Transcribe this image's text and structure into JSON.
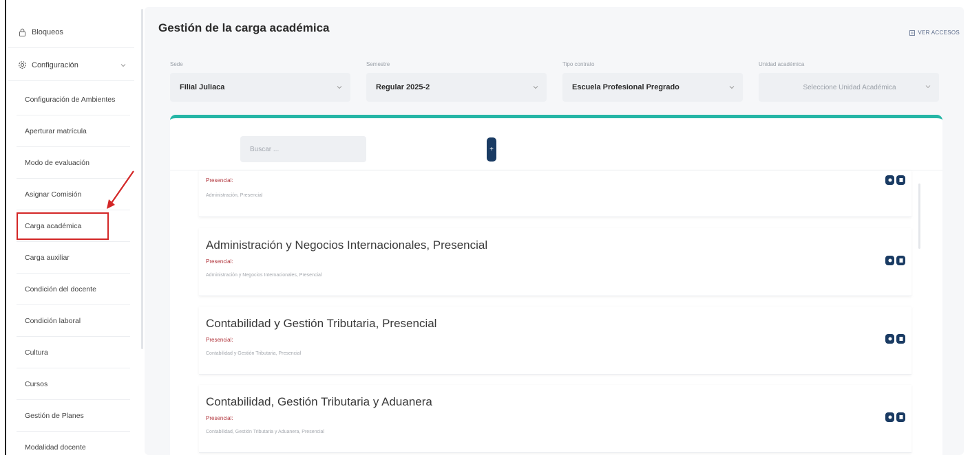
{
  "sidebar": {
    "top_items": [
      {
        "label": "Bloqueos",
        "icon": "lock-icon"
      },
      {
        "label": "Configuración",
        "icon": "gear-icon"
      }
    ],
    "sub_items": [
      {
        "label": "Configuración de Ambientes"
      },
      {
        "label": "Aperturar matrícula"
      },
      {
        "label": "Modo de evaluación"
      },
      {
        "label": "Asignar Comisión"
      },
      {
        "label": "Carga académica"
      },
      {
        "label": "Carga auxiliar"
      },
      {
        "label": "Condición del docente"
      },
      {
        "label": "Condición laboral"
      },
      {
        "label": "Cultura"
      },
      {
        "label": "Cursos"
      },
      {
        "label": "Gestión de Planes"
      },
      {
        "label": "Modalidad docente"
      }
    ],
    "highlighted_item": "Carga académica"
  },
  "header": {
    "title": "Gestión de la carga académica",
    "view_access_label": "VER ACCESOS"
  },
  "filters": [
    {
      "label": "Sede",
      "value": "Filial Juliaca"
    },
    {
      "label": "Semestre",
      "value": "Regular 2025-2"
    },
    {
      "label": "Tipo contrato",
      "value": "Escuela Profesional Pregrado"
    },
    {
      "label": "Unidad académica",
      "placeholder": "Seleccione Unidad Académica"
    }
  ],
  "toolbar": {
    "search_placeholder": "Buscar ...",
    "add_label": "+"
  },
  "list": [
    {
      "title": "",
      "type": "Presencial:",
      "desc": "Administración, Presencial"
    },
    {
      "title": "Administración y Negocios Internacionales, Presencial",
      "type": "Presencial:",
      "desc": "Administración y Negocios Internacionales, Presencial"
    },
    {
      "title": "Contabilidad y Gestión Tributaria, Presencial",
      "type": "Presencial:",
      "desc": "Contabilidad y Gestión Tributaria, Presencial"
    },
    {
      "title": "Contabilidad, Gestión Tributaria y Aduanera",
      "type": "Presencial:",
      "desc": "Contabilidad, Gestión Tributaria y Aduanera, Presencial"
    }
  ],
  "colors": {
    "accent_teal": "#25b6a6",
    "action_navy": "#1a3b63",
    "highlight_red": "#d32626",
    "type_red": "#b0333a"
  }
}
